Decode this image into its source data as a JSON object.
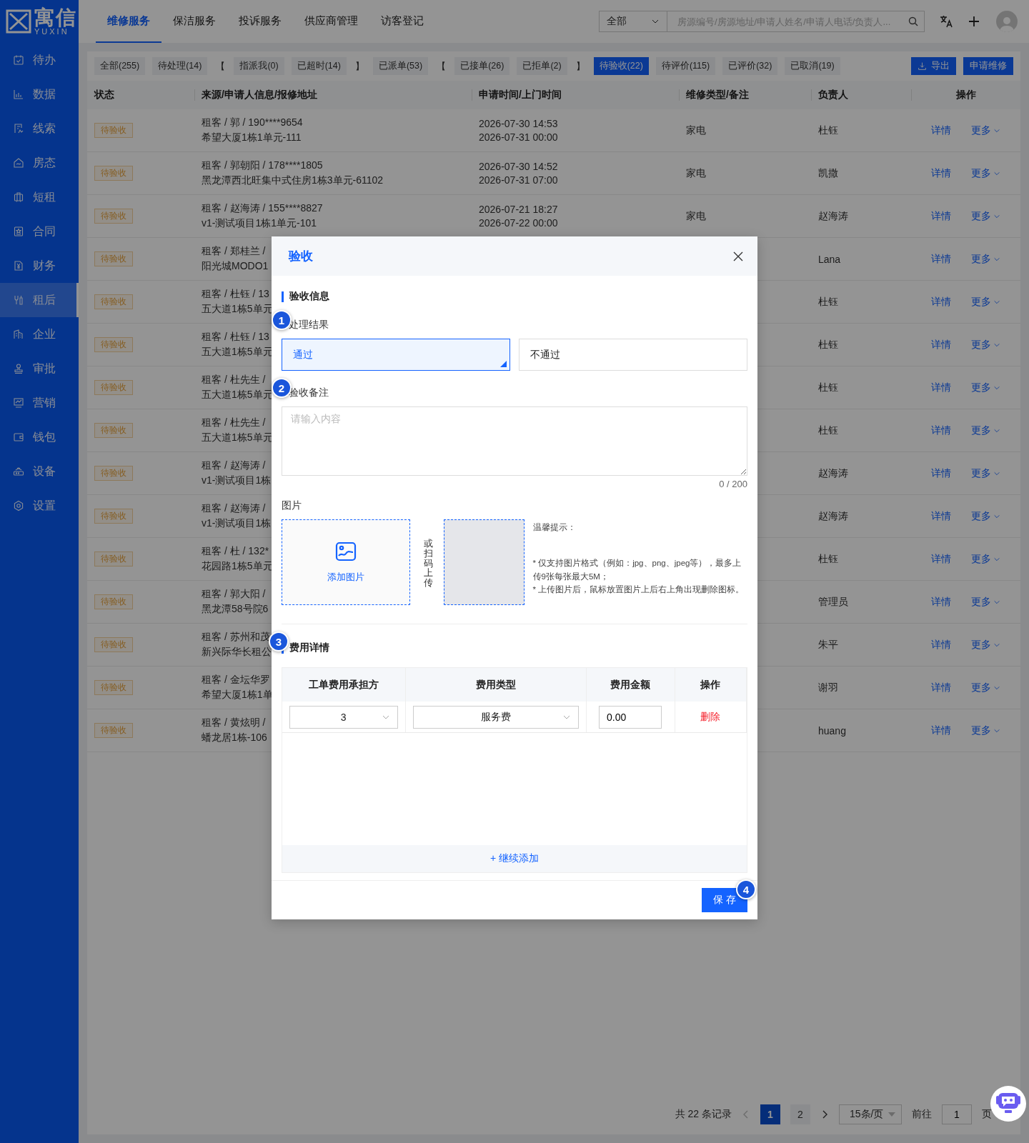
{
  "sidebar": {
    "logo": {
      "name": "寓信",
      "sub": "YUXIN"
    },
    "items": [
      {
        "label": "待办",
        "selected": false
      },
      {
        "label": "数据",
        "selected": false
      },
      {
        "label": "线索",
        "selected": false
      },
      {
        "label": "房态",
        "selected": false
      },
      {
        "label": "短租",
        "selected": false
      },
      {
        "label": "合同",
        "selected": false
      },
      {
        "label": "财务",
        "selected": false
      },
      {
        "label": "租后",
        "selected": true
      },
      {
        "label": "企业",
        "selected": false
      },
      {
        "label": "审批",
        "selected": false
      },
      {
        "label": "营销",
        "selected": false
      },
      {
        "label": "钱包",
        "selected": false
      },
      {
        "label": "设备",
        "selected": false
      },
      {
        "label": "设置",
        "selected": false
      }
    ]
  },
  "top_nav": {
    "tabs": [
      {
        "label": "维修服务",
        "selected": true
      },
      {
        "label": "保洁服务",
        "selected": false
      },
      {
        "label": "投诉服务",
        "selected": false
      },
      {
        "label": "供应商管理",
        "selected": false
      },
      {
        "label": "访客登记",
        "selected": false
      }
    ],
    "search": {
      "scope": "全部",
      "placeholder": "房源编号/房源地址/申请人姓名/申请人电话/负责人..."
    }
  },
  "filters": [
    {
      "label": "全部(255)",
      "kind": "chip",
      "selected": false
    },
    {
      "label": "待处理(14)",
      "kind": "chip",
      "selected": false
    },
    {
      "label": "【",
      "kind": "bracket"
    },
    {
      "label": "指派我(0)",
      "kind": "chip",
      "selected": false
    },
    {
      "label": "已超时(14)",
      "kind": "chip",
      "selected": false
    },
    {
      "label": "】",
      "kind": "bracket"
    },
    {
      "label": "已派单(53)",
      "kind": "chip",
      "selected": false
    },
    {
      "label": "【",
      "kind": "bracket"
    },
    {
      "label": "已接单(26)",
      "kind": "chip",
      "selected": false
    },
    {
      "label": "已拒单(2)",
      "kind": "chip",
      "selected": false
    },
    {
      "label": "】",
      "kind": "bracket"
    },
    {
      "label": "待验收(22)",
      "kind": "chip",
      "selected": true
    },
    {
      "label": "待评价(115)",
      "kind": "chip",
      "selected": false
    },
    {
      "label": "已评价(32)",
      "kind": "chip",
      "selected": false
    },
    {
      "label": "已取消(19)",
      "kind": "chip",
      "selected": false
    }
  ],
  "actions": [
    {
      "label": "导出"
    },
    {
      "label": "申请维修"
    }
  ],
  "table": {
    "columns": [
      "状态",
      "来源/申请人信息/报修地址",
      "申请时间/上门时间",
      "维修类型/备注",
      "负责人",
      "操作"
    ],
    "rows": [
      {
        "status": "待验收",
        "applicant": "租客 / 郭 / 190****9654",
        "address": "希望大厦1栋1单元-111",
        "times": [
          "2026-07-30 14:53",
          "2026-07-31 00:00"
        ],
        "type": "家电",
        "owner": "杜钰",
        "ops": [
          "详情",
          "更多"
        ]
      },
      {
        "status": "待验收",
        "applicant": "租客 / 郭朝阳 / 178****1805",
        "address": "黑龙潭西北旺集中式住房1栋3单元-61102",
        "times": [
          "2026-07-30 14:52",
          "2026-07-31 07:00"
        ],
        "type": "家电",
        "owner": "凯撒",
        "ops": [
          "详情",
          "更多"
        ]
      },
      {
        "status": "待验收",
        "applicant": "租客 / 赵海涛 / 155****8827",
        "address": "v1-测试项目1栋1单元-101",
        "times": [
          "2026-07-21 18:27",
          "2026-07-22 00:00"
        ],
        "type": "家电",
        "owner": "赵海涛",
        "ops": [
          "详情",
          "更多"
        ]
      },
      {
        "status": "待验收",
        "applicant": "租客 / 郑桂兰 /",
        "address": "阳光城MODO1",
        "owner": "Lana",
        "ops": [
          "详情",
          "更多"
        ]
      },
      {
        "status": "待验收",
        "applicant": "租客 / 杜钰 / 13",
        "address": "五大道1栋5单元",
        "owner": "杜钰",
        "ops": [
          "详情",
          "更多"
        ]
      },
      {
        "status": "待验收",
        "applicant": "租客 / 杜钰 / 13",
        "address": "五大道1栋5单元",
        "owner": "杜钰",
        "ops": [
          "详情",
          "更多"
        ]
      },
      {
        "status": "待验收",
        "applicant": "租客 / 杜先生 /",
        "address": "五大道1栋5单元",
        "owner": "杜钰",
        "ops": [
          "详情",
          "更多"
        ]
      },
      {
        "status": "待验收",
        "applicant": "租客 / 杜先生 /",
        "address": "五大道1栋5单元",
        "owner": "杜钰",
        "ops": [
          "详情",
          "更多"
        ]
      },
      {
        "status": "待验收",
        "applicant": "租客 / 赵海涛 /",
        "address": "v1-测试项目1栋",
        "owner": "赵海涛",
        "ops": [
          "详情",
          "更多"
        ]
      },
      {
        "status": "待验收",
        "applicant": "租客 / 赵海涛 /",
        "address": "v1-测试项目1栋",
        "owner": "赵海涛",
        "ops": [
          "详情",
          "更多"
        ]
      },
      {
        "status": "待验收",
        "applicant": "租客 / 杜 / 132*",
        "address": "花园路1栋5单元",
        "owner": "杜钰",
        "ops": [
          "详情",
          "更多"
        ]
      },
      {
        "status": "待验收",
        "applicant": "租客 / 郭大阳 /",
        "address": "黑龙潭58号院6",
        "owner": "管理员",
        "ops": [
          "详情",
          "更多"
        ]
      },
      {
        "status": "待验收",
        "applicant": "租客 / 苏州和茂",
        "address": "新兴际华长租公",
        "owner": "朱平",
        "ops": [
          "详情",
          "更多"
        ]
      },
      {
        "status": "待验收",
        "applicant": "租客 / 金坛华罗",
        "address": "希望大厦1栋1单",
        "owner": "谢羽",
        "ops": [
          "详情",
          "更多"
        ]
      },
      {
        "status": "待验收",
        "applicant": "租客 / 黄炫明 /",
        "address": "蟠龙居1栋-106",
        "owner": "huang",
        "ops": [
          "详情",
          "更多"
        ]
      }
    ]
  },
  "pagination": {
    "total": "共 22 条记录",
    "pages": [
      {
        "label": "1",
        "selected": true
      },
      {
        "label": "2",
        "selected": false
      }
    ],
    "page_size": "15条/页",
    "goto_label": "前往",
    "goto_value": "1",
    "page_suffix": "页"
  },
  "modal": {
    "title": "验收",
    "section_info": "验收信息",
    "result": {
      "label": "处理结果",
      "marker": "1",
      "options": [
        {
          "label": "通过",
          "selected": true
        },
        {
          "label": "不通过",
          "selected": false
        }
      ]
    },
    "remark": {
      "label": "验收备注",
      "marker": "2",
      "placeholder": "请输入内容",
      "count": "0 / 200"
    },
    "images": {
      "label": "图片",
      "add": "添加图片",
      "or_scan": "或扫码上传",
      "tips_title": "温馨提示：",
      "tips": [
        "* 仅支持图片格式（例如：jpg、png、jpeg等），最多上传9张每张最大5M；",
        "* 上传图片后，鼠标放置图片上后右上角出现删除图标。"
      ]
    },
    "fees": {
      "title": "费用详情",
      "marker": "3",
      "columns": [
        "工单费用承担方",
        "费用类型",
        "费用金额",
        "操作"
      ],
      "rows": [
        {
          "payer": "3",
          "fee_type": "服务费",
          "amount": "0.00",
          "action": "删除"
        }
      ],
      "add": "+ 继续添加"
    },
    "save": {
      "label": "保 存",
      "marker": "4"
    }
  }
}
